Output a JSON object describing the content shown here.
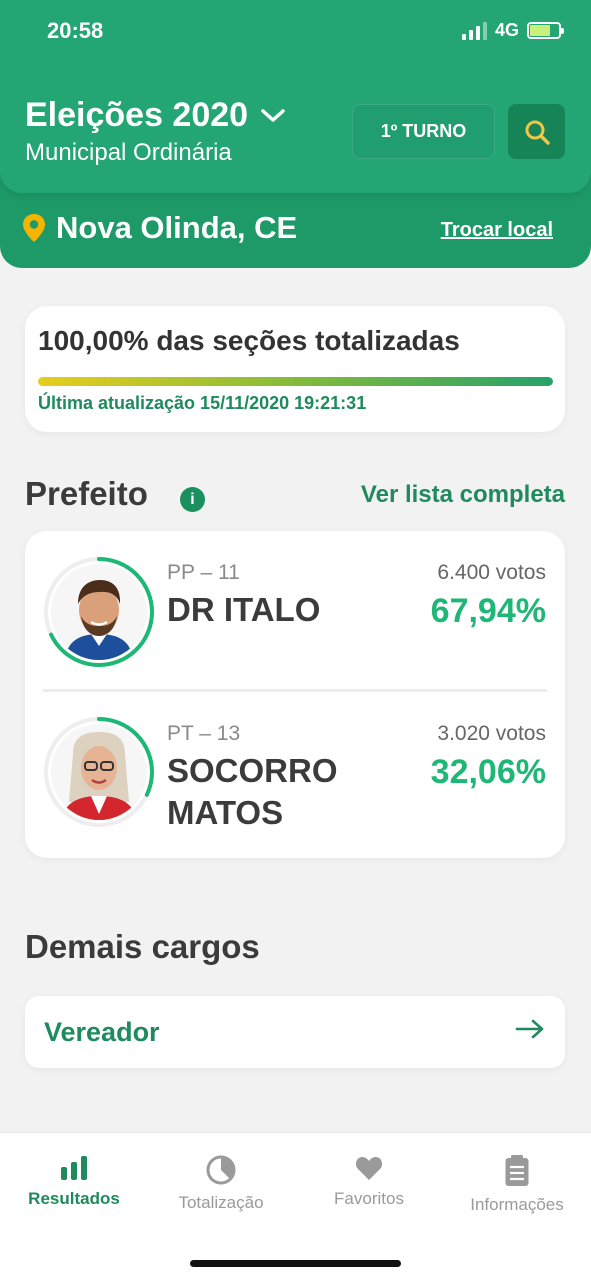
{
  "status_bar": {
    "time": "20:58",
    "network": "4G"
  },
  "header": {
    "title": "Eleições 2020",
    "subtitle": "Municipal Ordinária",
    "turno_button": "1º TURNO",
    "location": "Nova Olinda, CE",
    "change_location": "Trocar local"
  },
  "progress": {
    "title": "100,00% das seções totalizadas",
    "fraction": 1.0,
    "updated": "Última atualização 15/11/2020 19:21:31"
  },
  "prefeito": {
    "title": "Prefeito",
    "see_all": "Ver lista completa",
    "candidates": [
      {
        "party": "PP – 11",
        "name": "DR ITALO",
        "votes": "6.400 votos",
        "percent": "67,94%",
        "share": 0.6794
      },
      {
        "party": "PT – 13",
        "name": "SOCORRO MATOS",
        "votes": "3.020 votos",
        "percent": "32,06%",
        "share": 0.3206
      }
    ]
  },
  "demais": {
    "title": "Demais cargos",
    "items": [
      {
        "label": "Vereador"
      }
    ]
  },
  "tabbar": {
    "tabs": [
      {
        "label": "Resultados",
        "icon": "bar-chart-icon",
        "active": true
      },
      {
        "label": "Totalização",
        "icon": "pie-chart-icon",
        "active": false
      },
      {
        "label": "Favoritos",
        "icon": "heart-icon",
        "active": false
      },
      {
        "label": "Informações",
        "icon": "document-icon",
        "active": false
      }
    ]
  },
  "colors": {
    "brand": "#23a574",
    "accent": "#1fb776",
    "link": "#1f8a5d",
    "pin": "#f4b400",
    "search_icon": "#f4c542"
  }
}
